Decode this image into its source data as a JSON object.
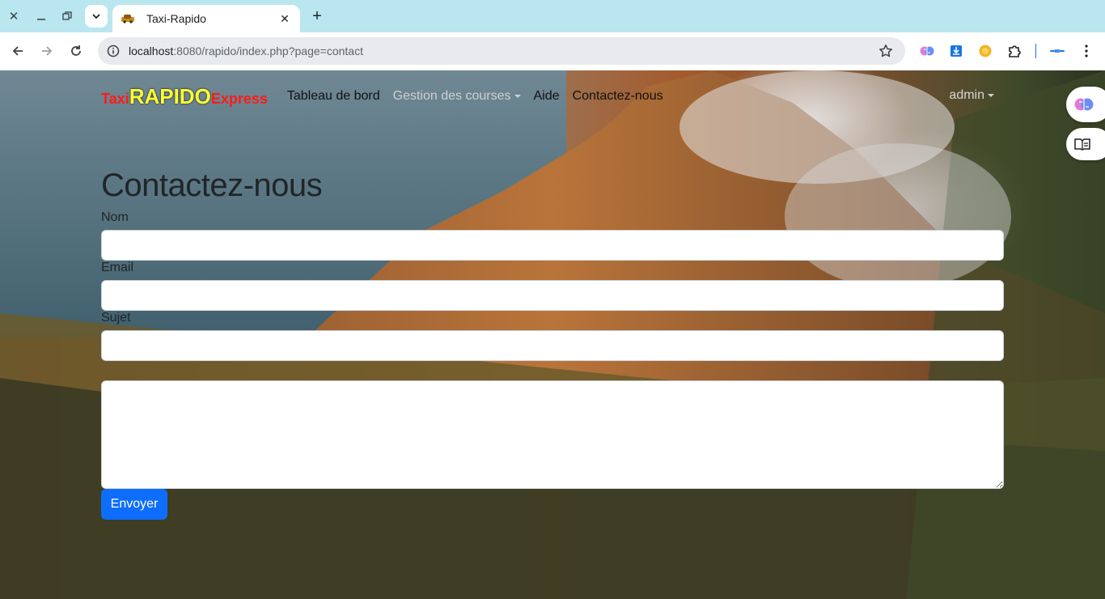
{
  "browser": {
    "tab_title": "Taxi-Rapido",
    "url_host": "localhost",
    "url_rest": ":8080/rapido/index.php?page=contact"
  },
  "navbar": {
    "brand_taxi": "Taxi",
    "brand_rapido": "RAPIDO",
    "brand_express": "Express",
    "links": {
      "dashboard": "Tableau de bord",
      "courses": "Gestion des courses",
      "help": "Aide",
      "contact": "Contactez-nous"
    },
    "user": "admin"
  },
  "form": {
    "heading": "Contactez-nous",
    "name_label": "Nom",
    "email_label": "Email",
    "subject_label": "Sujet",
    "submit_label": "Envoyer"
  },
  "colors": {
    "brand_red": "#ff1a1a",
    "brand_yellow": "#ffff33",
    "primary": "#0d6efd"
  }
}
